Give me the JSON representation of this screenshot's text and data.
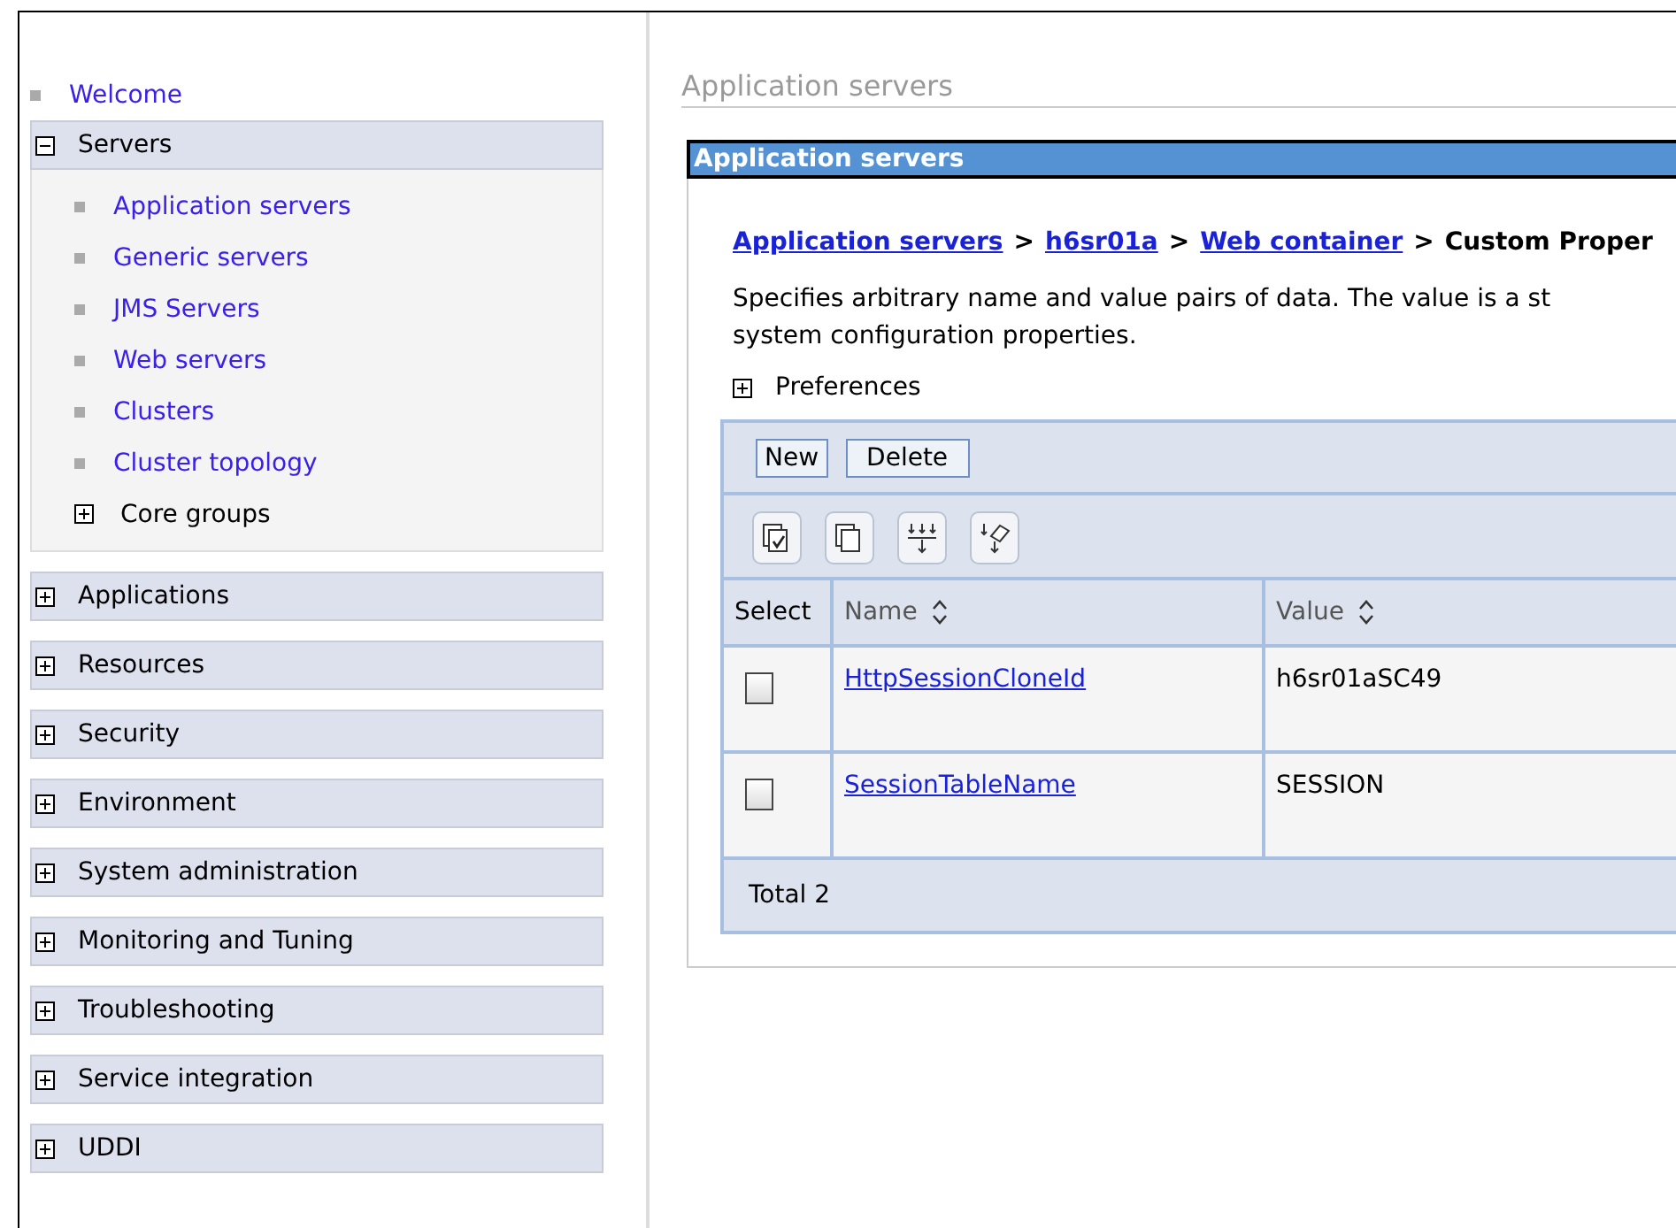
{
  "nav": {
    "welcome": "Welcome",
    "sections": [
      {
        "label": "Servers",
        "expanded": true,
        "children": [
          {
            "kind": "link",
            "label": "Application servers"
          },
          {
            "kind": "link",
            "label": "Generic servers"
          },
          {
            "kind": "link",
            "label": "JMS Servers"
          },
          {
            "kind": "link",
            "label": "Web servers"
          },
          {
            "kind": "link",
            "label": "Clusters"
          },
          {
            "kind": "link",
            "label": "Cluster topology"
          },
          {
            "kind": "group",
            "label": "Core groups",
            "expanded": false
          }
        ]
      },
      {
        "label": "Applications",
        "expanded": false
      },
      {
        "label": "Resources",
        "expanded": false
      },
      {
        "label": "Security",
        "expanded": false
      },
      {
        "label": "Environment",
        "expanded": false
      },
      {
        "label": "System administration",
        "expanded": false
      },
      {
        "label": "Monitoring and Tuning",
        "expanded": false
      },
      {
        "label": "Troubleshooting",
        "expanded": false
      },
      {
        "label": "Service integration",
        "expanded": false
      },
      {
        "label": "UDDI",
        "expanded": false
      }
    ]
  },
  "page_title": "Application servers",
  "panel": {
    "title": "Application servers",
    "breadcrumb": [
      {
        "kind": "link",
        "label": "Application servers"
      },
      {
        "kind": "separator",
        "label": ">"
      },
      {
        "kind": "link",
        "label": "h6sr01a"
      },
      {
        "kind": "separator",
        "label": ">"
      },
      {
        "kind": "link",
        "label": "Web container"
      },
      {
        "kind": "separator",
        "label": ">"
      },
      {
        "kind": "current",
        "label": "Custom Proper"
      }
    ],
    "description_lines": [
      "Specifies arbitrary name and value pairs of data. The value is a st",
      "system configuration properties."
    ],
    "preferences": {
      "label": "Preferences",
      "expanded": false
    },
    "buttons": [
      "New",
      "Delete"
    ],
    "table": {
      "columns": [
        {
          "label": "Select",
          "sortable": false
        },
        {
          "label": "Name",
          "sortable": true
        },
        {
          "label": "Value",
          "sortable": true
        }
      ],
      "rows": [
        {
          "checked": false,
          "name": "HttpSessionCloneId",
          "value": "h6sr01aSC49"
        },
        {
          "checked": false,
          "name": "SessionTableName",
          "value": "SESSION"
        }
      ],
      "total": "Total 2"
    }
  }
}
